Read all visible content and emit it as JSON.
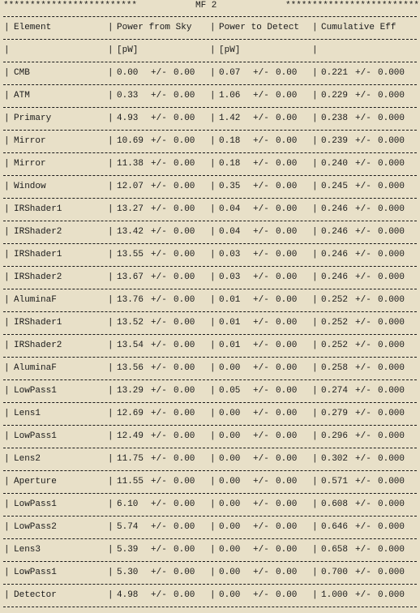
{
  "title": {
    "left_stars": "*************************",
    "text": "MF 2",
    "right_stars": "*************************"
  },
  "header": {
    "element": "Element",
    "power_sky": "Power from Sky",
    "power_detect": "Power to Detect",
    "cum_eff": "Cumulative Eff"
  },
  "units": {
    "element": "",
    "power_sky": "[pW]",
    "power_detect": "[pW]",
    "cum_eff": ""
  },
  "rows": [
    {
      "element": "CMB",
      "sky": "0.00",
      "sky_err": "0.00",
      "det": "0.07",
      "det_err": "0.00",
      "eff": "0.221",
      "eff_err": "0.000"
    },
    {
      "element": "ATM",
      "sky": "0.33",
      "sky_err": "0.00",
      "det": "1.06",
      "det_err": "0.00",
      "eff": "0.229",
      "eff_err": "0.000"
    },
    {
      "element": "Primary",
      "sky": "4.93",
      "sky_err": "0.00",
      "det": "1.42",
      "det_err": "0.00",
      "eff": "0.238",
      "eff_err": "0.000"
    },
    {
      "element": "Mirror",
      "sky": "10.69",
      "sky_err": "0.00",
      "det": "0.18",
      "det_err": "0.00",
      "eff": "0.239",
      "eff_err": "0.000"
    },
    {
      "element": "Mirror",
      "sky": "11.38",
      "sky_err": "0.00",
      "det": "0.18",
      "det_err": "0.00",
      "eff": "0.240",
      "eff_err": "0.000"
    },
    {
      "element": "Window",
      "sky": "12.07",
      "sky_err": "0.00",
      "det": "0.35",
      "det_err": "0.00",
      "eff": "0.245",
      "eff_err": "0.000"
    },
    {
      "element": "IRShader1",
      "sky": "13.27",
      "sky_err": "0.00",
      "det": "0.04",
      "det_err": "0.00",
      "eff": "0.246",
      "eff_err": "0.000"
    },
    {
      "element": "IRShader2",
      "sky": "13.42",
      "sky_err": "0.00",
      "det": "0.04",
      "det_err": "0.00",
      "eff": "0.246",
      "eff_err": "0.000"
    },
    {
      "element": "IRShader1",
      "sky": "13.55",
      "sky_err": "0.00",
      "det": "0.03",
      "det_err": "0.00",
      "eff": "0.246",
      "eff_err": "0.000"
    },
    {
      "element": "IRShader2",
      "sky": "13.67",
      "sky_err": "0.00",
      "det": "0.03",
      "det_err": "0.00",
      "eff": "0.246",
      "eff_err": "0.000"
    },
    {
      "element": "AluminaF",
      "sky": "13.76",
      "sky_err": "0.00",
      "det": "0.01",
      "det_err": "0.00",
      "eff": "0.252",
      "eff_err": "0.000"
    },
    {
      "element": "IRShader1",
      "sky": "13.52",
      "sky_err": "0.00",
      "det": "0.01",
      "det_err": "0.00",
      "eff": "0.252",
      "eff_err": "0.000"
    },
    {
      "element": "IRShader2",
      "sky": "13.54",
      "sky_err": "0.00",
      "det": "0.01",
      "det_err": "0.00",
      "eff": "0.252",
      "eff_err": "0.000"
    },
    {
      "element": "AluminaF",
      "sky": "13.56",
      "sky_err": "0.00",
      "det": "0.00",
      "det_err": "0.00",
      "eff": "0.258",
      "eff_err": "0.000"
    },
    {
      "element": "LowPass1",
      "sky": "13.29",
      "sky_err": "0.00",
      "det": "0.05",
      "det_err": "0.00",
      "eff": "0.274",
      "eff_err": "0.000"
    },
    {
      "element": "Lens1",
      "sky": "12.69",
      "sky_err": "0.00",
      "det": "0.00",
      "det_err": "0.00",
      "eff": "0.279",
      "eff_err": "0.000"
    },
    {
      "element": "LowPass1",
      "sky": "12.49",
      "sky_err": "0.00",
      "det": "0.00",
      "det_err": "0.00",
      "eff": "0.296",
      "eff_err": "0.000"
    },
    {
      "element": "Lens2",
      "sky": "11.75",
      "sky_err": "0.00",
      "det": "0.00",
      "det_err": "0.00",
      "eff": "0.302",
      "eff_err": "0.000"
    },
    {
      "element": "Aperture",
      "sky": "11.55",
      "sky_err": "0.00",
      "det": "0.00",
      "det_err": "0.00",
      "eff": "0.571",
      "eff_err": "0.000"
    },
    {
      "element": "LowPass1",
      "sky": "6.10",
      "sky_err": "0.00",
      "det": "0.00",
      "det_err": "0.00",
      "eff": "0.608",
      "eff_err": "0.000"
    },
    {
      "element": "LowPass2",
      "sky": "5.74",
      "sky_err": "0.00",
      "det": "0.00",
      "det_err": "0.00",
      "eff": "0.646",
      "eff_err": "0.000"
    },
    {
      "element": "Lens3",
      "sky": "5.39",
      "sky_err": "0.00",
      "det": "0.00",
      "det_err": "0.00",
      "eff": "0.658",
      "eff_err": "0.000"
    },
    {
      "element": "LowPass1",
      "sky": "5.30",
      "sky_err": "0.00",
      "det": "0.00",
      "det_err": "0.00",
      "eff": "0.700",
      "eff_err": "0.000"
    },
    {
      "element": "Detector",
      "sky": "4.98",
      "sky_err": "0.00",
      "det": "0.00",
      "det_err": "0.00",
      "eff": "1.000",
      "eff_err": "0.000"
    }
  ],
  "symbols": {
    "pm": "+/-",
    "bar": "|"
  }
}
